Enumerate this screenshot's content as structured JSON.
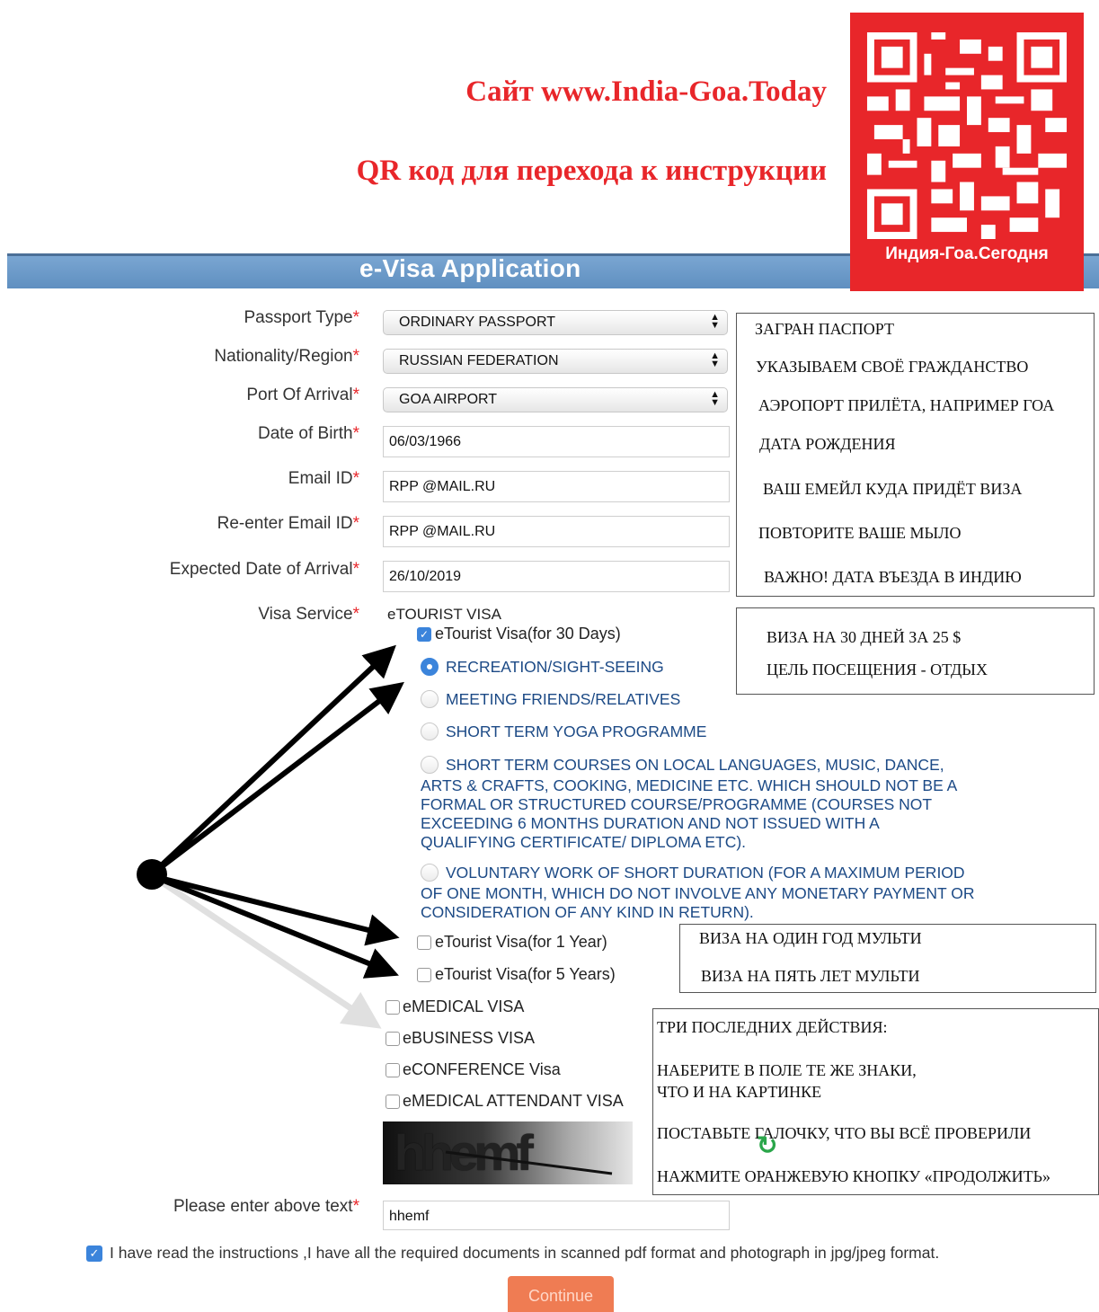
{
  "header": {
    "site_title": "Сайт www.India-Goa.Today",
    "qr_title": "QR код для перехода к инструкции",
    "qr_caption": "Индия-Гоа.Сегодня",
    "banner": "e-Visa Application"
  },
  "form": {
    "required_mark": "*",
    "passport_type": {
      "label": "Passport Type",
      "value": "ORDINARY PASSPORT"
    },
    "nationality": {
      "label": "Nationality/Region",
      "value": "RUSSIAN FEDERATION"
    },
    "port": {
      "label": "Port Of Arrival",
      "value": "GOA AIRPORT"
    },
    "dob": {
      "label": "Date of Birth",
      "value": "06/03/1966"
    },
    "email": {
      "label": "Email ID",
      "value": "RPP    @MAIL.RU"
    },
    "email2": {
      "label": "Re-enter Email ID",
      "value": "RPP    @MAIL.RU"
    },
    "arrival": {
      "label": "Expected Date of Arrival",
      "value": "26/10/2019"
    },
    "visa_service": {
      "label": "Visa Service",
      "group": "eTOURIST VISA"
    },
    "captcha_label": "Please enter above text",
    "captcha_image_text": "hhemf",
    "captcha_value": "hhemf"
  },
  "visa": {
    "tourist_30": "eTourist Visa(for 30 Days)",
    "purposes": [
      "RECREATION/SIGHT-SEEING",
      "MEETING FRIENDS/RELATIVES",
      "SHORT TERM YOGA PROGRAMME",
      "SHORT TERM COURSES ON LOCAL LANGUAGES, MUSIC, DANCE,",
      "ARTS & CRAFTS, COOKING, MEDICINE ETC. WHICH SHOULD NOT BE A",
      "FORMAL OR STRUCTURED COURSE/PROGRAMME (COURSES NOT",
      "EXCEEDING 6 MONTHS DURATION AND NOT ISSUED WITH A",
      "QUALIFYING CERTIFICATE/ DIPLOMA ETC).",
      "VOLUNTARY WORK OF SHORT DURATION (FOR A MAXIMUM PERIOD",
      "OF ONE MONTH, WHICH DO NOT INVOLVE ANY MONETARY PAYMENT OR",
      "CONSIDERATION OF ANY KIND IN RETURN)."
    ],
    "tourist_1y": "eTourist Visa(for 1 Year)",
    "tourist_5y": "eTourist Visa(for 5 Years)",
    "medical": "eMEDICAL VISA",
    "business": "eBUSINESS VISA",
    "conference": "eCONFERENCE Visa",
    "medical_attendant": "eMEDICAL ATTENDANT VISA"
  },
  "notes": {
    "passport": "ЗАГРАН  ПАСПОРТ",
    "nationality": "УКАЗЫВАЕМ СВОЁ ГРАЖДАНСТВО",
    "port": "АЭРОПОРТ ПРИЛЁТА, НАПРИМЕР ГОА",
    "dob": "ДАТА РОЖДЕНИЯ",
    "email": "ВАШ ЕМЕЙЛ КУДА ПРИДЁТ ВИЗА",
    "email2": "ПОВТОРИТЕ ВАШЕ МЫЛО",
    "arrival": "ВАЖНО! ДАТА ВЪЕЗДА В ИНДИЮ",
    "visa30": "ВИЗА НА 30 ДНЕЙ ЗА 25 $",
    "purpose": "ЦЕЛЬ ПОСЕЩЕНИЯ - ОТДЫХ",
    "visa1y": "ВИЗА НА ОДИН ГОД МУЛЬТИ",
    "visa5y": "ВИЗА НА ПЯТЬ ЛЕТ МУЛЬТИ",
    "final_title": "ТРИ ПОСЛЕДНИХ ДЕЙСТВИЯ:",
    "final_1a": "НАБЕРИТЕ В ПОЛЕ ТЕ ЖЕ ЗНАКИ,",
    "final_1b": "ЧТО И НА КАРТИНКЕ",
    "final_2": "ПОСТАВЬТЕ ГАЛОЧКУ, ЧТО ВЫ ВСЁ ПРОВЕРИЛИ",
    "final_3": "НАЖМИТЕ ОРАНЖЕВУЮ КНОПКУ «ПРОДОЛЖИТЬ»"
  },
  "footer": {
    "confirm_text": "I have read the instructions ,I have all the required documents in scanned pdf format and photograph in jpg/jpeg format.",
    "continue": "Continue"
  },
  "colors": {
    "accent_red": "#e8262a",
    "banner_blue": "#6a99c8",
    "link_blue": "#1c4a86",
    "button_orange": "#ef7c53"
  }
}
